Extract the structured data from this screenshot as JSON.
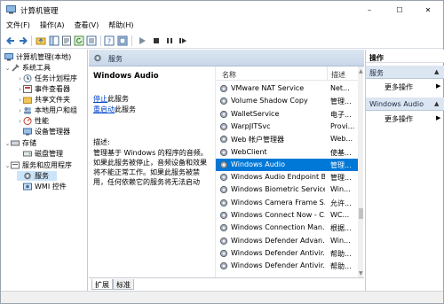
{
  "window": {
    "title": "计算机管理",
    "controls": {
      "minimize": "–",
      "maximize": "☐",
      "close": "✕"
    }
  },
  "menu": [
    "文件(F)",
    "操作(A)",
    "查看(V)",
    "帮助(H)"
  ],
  "tree": {
    "root": "计算机管理(本地)",
    "items": [
      {
        "label": "系统工具",
        "chevron": "⌄"
      },
      {
        "label": "任务计划程序",
        "chevron": "›"
      },
      {
        "label": "事件查看器",
        "chevron": "›"
      },
      {
        "label": "共享文件夹",
        "chevron": "›"
      },
      {
        "label": "本地用户和组",
        "chevron": "›"
      },
      {
        "label": "性能",
        "chevron": "›"
      },
      {
        "label": "设备管理器",
        "chevron": ""
      },
      {
        "label": "存储",
        "chevron": "⌄"
      },
      {
        "label": "磁盘管理",
        "chevron": ""
      },
      {
        "label": "服务和应用程序",
        "chevron": "⌄"
      },
      {
        "label": "服务",
        "chevron": ""
      },
      {
        "label": "WMI 控件",
        "chevron": ""
      }
    ]
  },
  "middle": {
    "header": "服务",
    "selected_service": "Windows Audio",
    "stop_link": "停止",
    "stop_suffix": "此服务",
    "restart_link": "重启动",
    "restart_suffix": "此服务",
    "desc_label": "描述:",
    "description": "管理基于 Windows 的程序的音频。如果此服务被停止，音频设备和效果将不能正常工作。如果此服务被禁用，任何依赖它的服务将无法启动",
    "columns": {
      "name": "名称",
      "description": "描述"
    },
    "services": [
      {
        "name": "VMware NAT Service",
        "desc": "Net..."
      },
      {
        "name": "Volume Shadow Copy",
        "desc": "管理..."
      },
      {
        "name": "WalletService",
        "desc": "电子..."
      },
      {
        "name": "WarpJITSvc",
        "desc": "Provi..."
      },
      {
        "name": "Web 帐户管理器",
        "desc": "Web..."
      },
      {
        "name": "WebClient",
        "desc": "使基..."
      },
      {
        "name": "Windows Audio",
        "desc": "管理..."
      },
      {
        "name": "Windows Audio Endpoint B...",
        "desc": "管理..."
      },
      {
        "name": "Windows Biometric Service",
        "desc": "Win..."
      },
      {
        "name": "Windows Camera Frame S...",
        "desc": "允许..."
      },
      {
        "name": "Windows Connect Now - C...",
        "desc": "WC..."
      },
      {
        "name": "Windows Connection Man...",
        "desc": "根据..."
      },
      {
        "name": "Windows Defender Advan...",
        "desc": "Win..."
      },
      {
        "name": "Windows Defender Antivir...",
        "desc": "帮助..."
      },
      {
        "name": "Windows Defender Antivir...",
        "desc": "帮助..."
      }
    ],
    "selected_index": 6,
    "tabs": [
      "扩展",
      "标准"
    ]
  },
  "actions": {
    "title": "操作",
    "sections": [
      {
        "label": "服务",
        "more": "更多操作"
      },
      {
        "label": "Windows Audio",
        "more": "更多操作"
      }
    ]
  },
  "colors": {
    "accent": "#0078d7",
    "pane_header": "#dce6f2"
  }
}
